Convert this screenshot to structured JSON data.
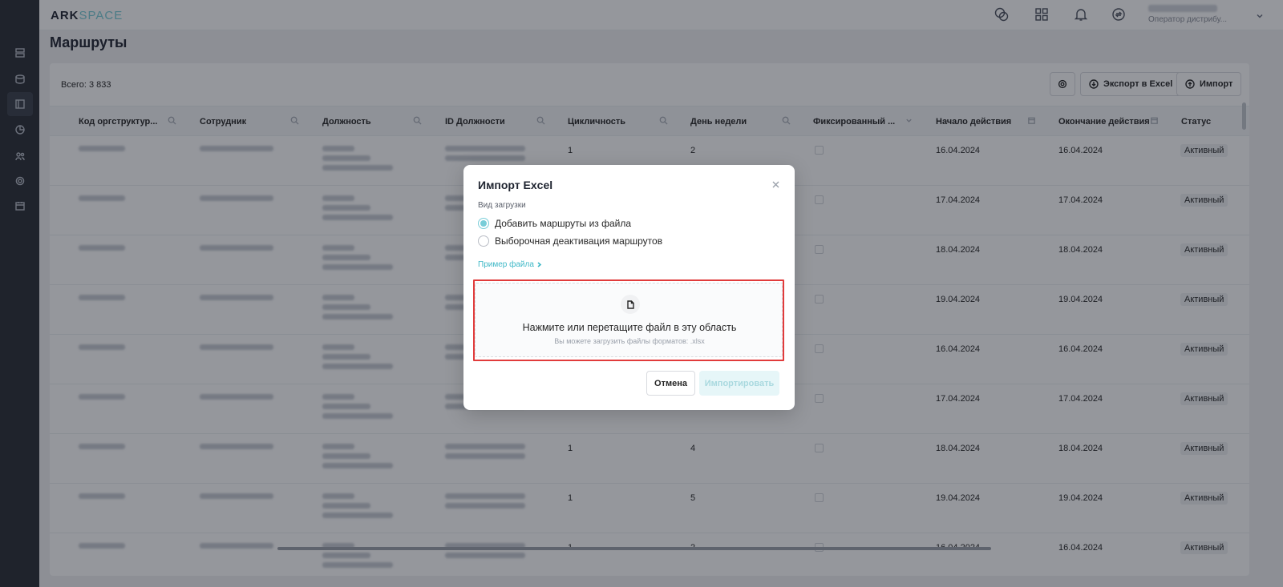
{
  "app": {
    "logo_a": "ARK",
    "logo_b": "SPACE"
  },
  "user": {
    "role": "Оператор дистрибу..."
  },
  "page": {
    "title": "Маршруты",
    "total": "Всего: 3 833"
  },
  "toolbar": {
    "export_label": "Экспорт в Excel",
    "import_label": "Импорт"
  },
  "columns": [
    "Код оргструктур...",
    "Сотрудник",
    "Должность",
    "ID Должности",
    "Цикличность",
    "День недели",
    "Фиксированный ...",
    "Начало действия",
    "Окончание действия",
    "Статус"
  ],
  "rows": [
    {
      "cycle": "1",
      "day": "2",
      "start": "16.04.2024",
      "end": "16.04.2024",
      "status": "Активный"
    },
    {
      "cycle": "",
      "day": "",
      "start": "17.04.2024",
      "end": "17.04.2024",
      "status": "Активный"
    },
    {
      "cycle": "",
      "day": "",
      "start": "18.04.2024",
      "end": "18.04.2024",
      "status": "Активный"
    },
    {
      "cycle": "",
      "day": "",
      "start": "19.04.2024",
      "end": "19.04.2024",
      "status": "Активный"
    },
    {
      "cycle": "",
      "day": "",
      "start": "16.04.2024",
      "end": "16.04.2024",
      "status": "Активный"
    },
    {
      "cycle": "",
      "day": "",
      "start": "17.04.2024",
      "end": "17.04.2024",
      "status": "Активный"
    },
    {
      "cycle": "1",
      "day": "4",
      "start": "18.04.2024",
      "end": "18.04.2024",
      "status": "Активный"
    },
    {
      "cycle": "1",
      "day": "5",
      "start": "19.04.2024",
      "end": "19.04.2024",
      "status": "Активный"
    },
    {
      "cycle": "1",
      "day": "2",
      "start": "16.04.2024",
      "end": "16.04.2024",
      "status": "Активный"
    }
  ],
  "modal": {
    "title": "Импорт Excel",
    "upload_type_label": "Вид загрузки",
    "option_add": "Добавить маршруты из файла",
    "option_deactivate": "Выборочная деактивация маршрутов",
    "selected_option": "option_add",
    "sample_link": "Пример файла",
    "dropzone_text": "Нажмите или перетащите файл в эту область",
    "dropzone_hint": "Вы можете загрузить файлы форматов: .xlsx",
    "cancel_label": "Отмена",
    "import_label": "Импортировать"
  },
  "colors": {
    "accent": "#79cdd8",
    "highlight": "#e13b3b",
    "sidebar": "#282c34"
  }
}
